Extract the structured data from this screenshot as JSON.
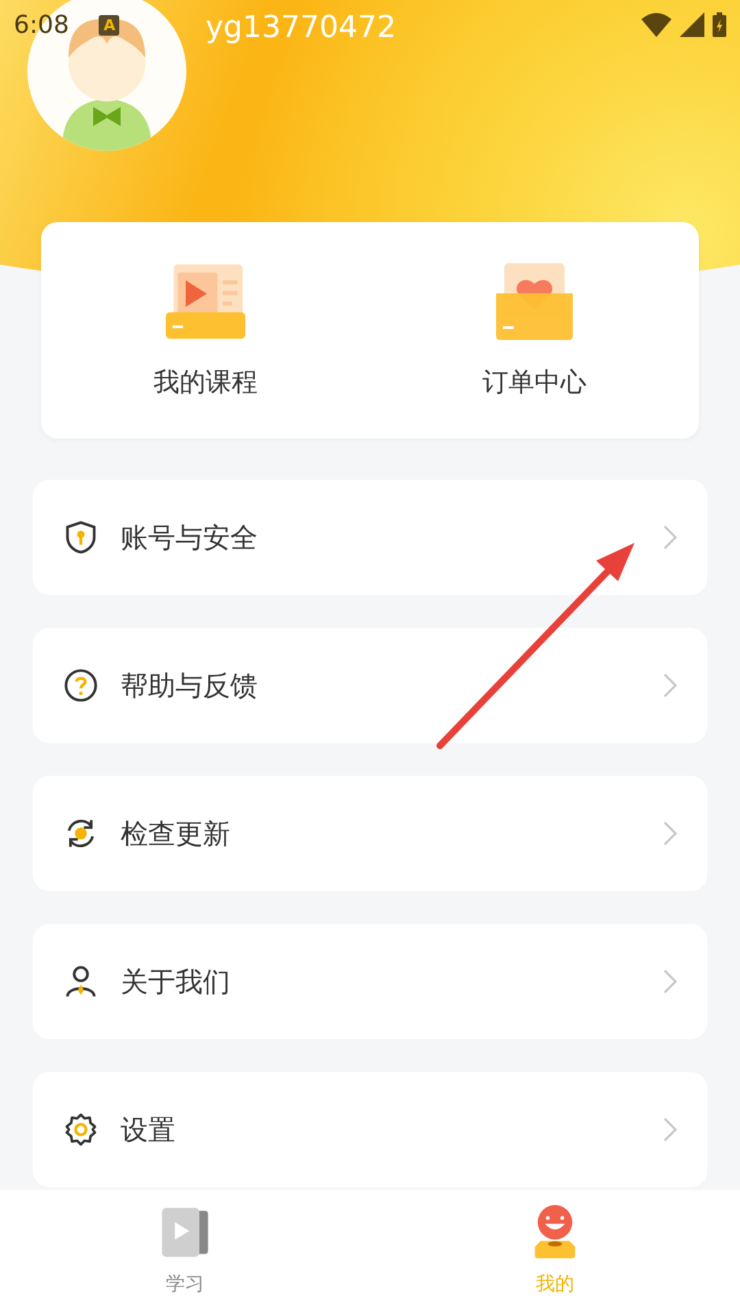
{
  "status_bar": {
    "time": "6:08",
    "notification": "A"
  },
  "profile": {
    "username": "yg13770472"
  },
  "shortcuts": [
    {
      "kind": "course",
      "label": "我的课程"
    },
    {
      "kind": "order",
      "label": "订单中心"
    }
  ],
  "menu": [
    {
      "kind": "shield",
      "label": "账号与安全"
    },
    {
      "kind": "help",
      "label": "帮助与反馈"
    },
    {
      "kind": "update",
      "label": "检查更新"
    },
    {
      "kind": "person",
      "label": "关于我们"
    },
    {
      "kind": "gear",
      "label": "设置"
    }
  ],
  "tabs": [
    {
      "kind": "study",
      "label": "学习",
      "selected": false
    },
    {
      "kind": "mine",
      "label": "我的",
      "selected": true
    }
  ]
}
